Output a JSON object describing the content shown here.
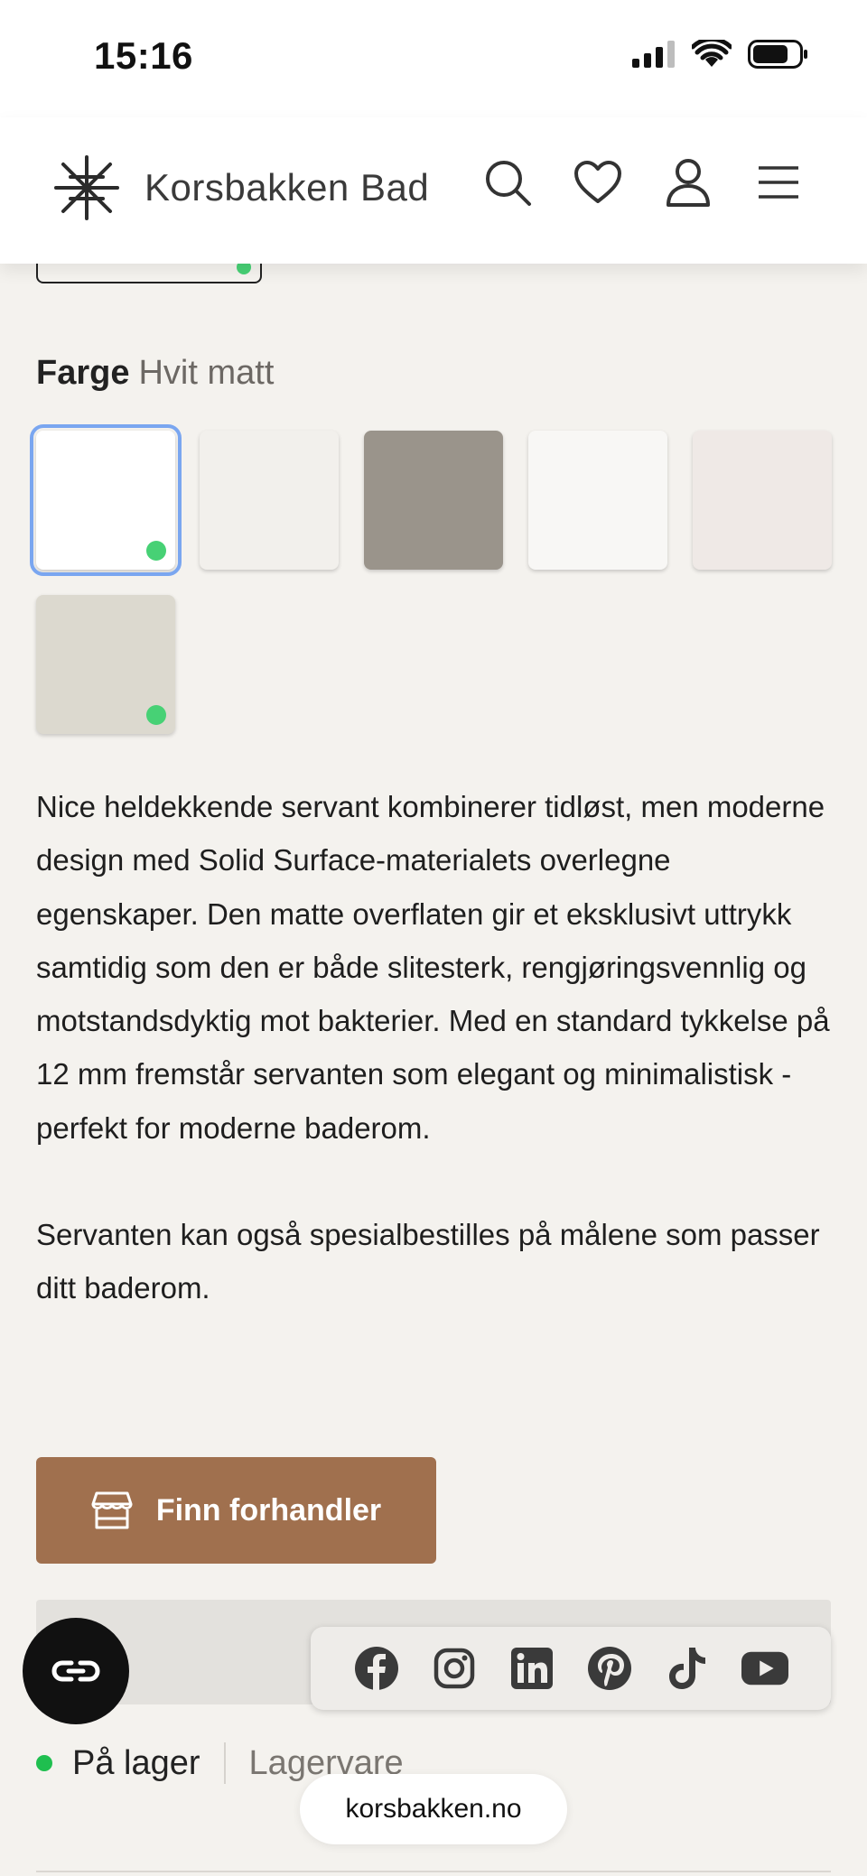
{
  "status": {
    "time": "15:16"
  },
  "header": {
    "brand": "Korsbakken Bad"
  },
  "color": {
    "label": "Farge",
    "selected": "Hvit matt",
    "swatches": [
      {
        "color": "#ffffff",
        "selected": true,
        "in_stock": true
      },
      {
        "color": "#f2f0ec",
        "selected": false,
        "in_stock": false
      },
      {
        "color": "#9a948b",
        "selected": false,
        "in_stock": false
      },
      {
        "color": "#f8f7f5",
        "selected": false,
        "in_stock": false
      },
      {
        "color": "#efe9e6",
        "selected": false,
        "in_stock": false
      },
      {
        "color": "#dcd9cf",
        "selected": false,
        "in_stock": true
      }
    ]
  },
  "description": {
    "p1": "Nice heldekkende servant kombinerer tidløst, men moderne design med Solid Surface-materialets overlegne egenskaper. Den matte overflaten gir et eksklusivt uttrykk samtidig som den er både slitesterk, rengjøringsvennlig og motstandsdyktig mot bakterier. Med en standard tykkelse på 12 mm fremstår servanten som elegant og minimalistisk - perfekt for moderne baderom.",
    "p2": "Servanten kan også spesialbestilles på målene som passer ditt baderom."
  },
  "cta": {
    "finn_label": "Finn forhandler"
  },
  "stock": {
    "status": "På lager",
    "type": "Lagervare"
  },
  "browser": {
    "url": "korsbakken.no"
  },
  "colors": {
    "accent_brown": "#a0704e",
    "stock_green": "#1fbf4f",
    "select_blue": "#7aa6f0"
  },
  "social": [
    "facebook-icon",
    "instagram-icon",
    "linkedin-icon",
    "pinterest-icon",
    "tiktok-icon",
    "youtube-icon"
  ]
}
